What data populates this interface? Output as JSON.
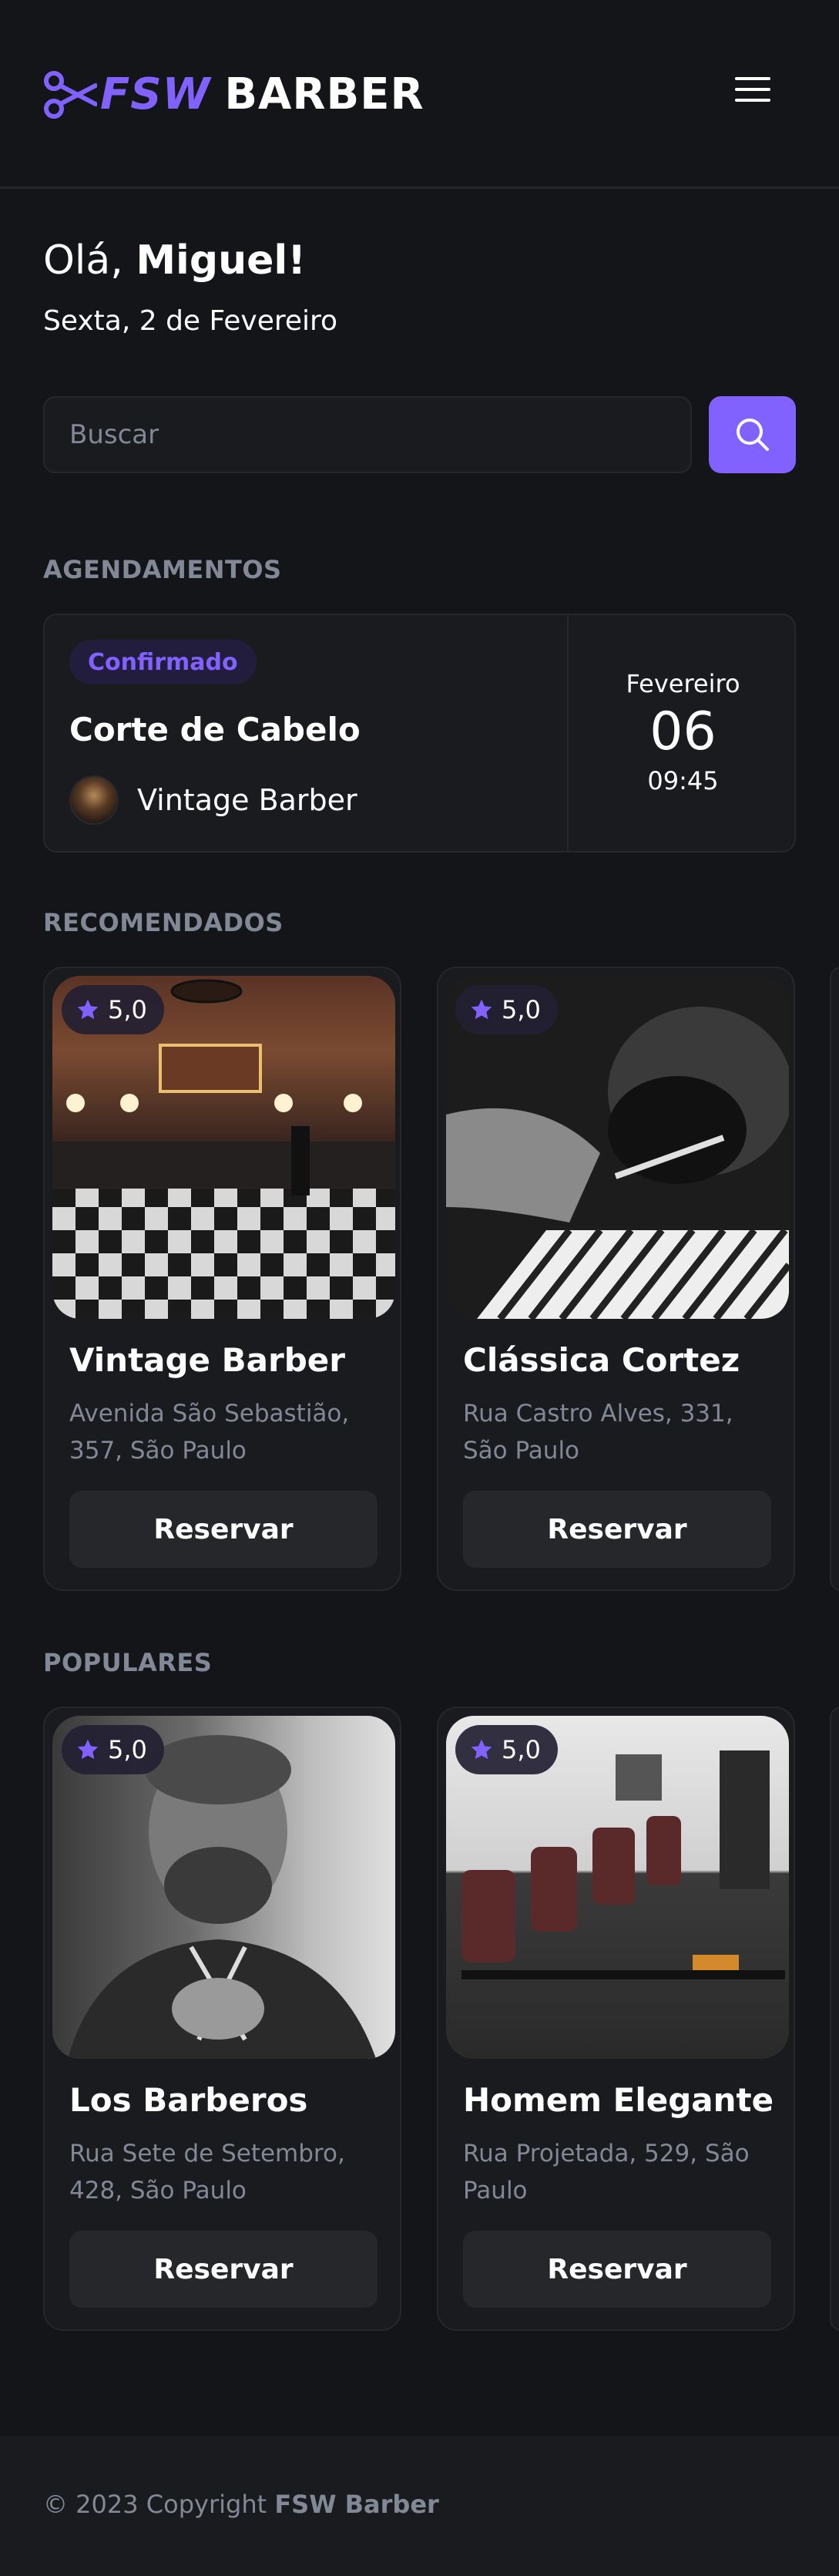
{
  "header": {
    "logo_part1": "FSW",
    "logo_part2": "BARBER",
    "brand_color": "#8162ff",
    "menu_icon": "hamburger-menu-icon"
  },
  "welcome": {
    "greeting_prefix": "Olá, ",
    "user_name": "Miguel!",
    "date": "Sexta, 2 de Fevereiro"
  },
  "search": {
    "placeholder": "Buscar",
    "button_icon": "search-icon"
  },
  "bookings": {
    "section_title": "Agendamentos",
    "items": [
      {
        "status": "Confirmado",
        "service": "Corte de Cabelo",
        "barbershop": "Vintage Barber",
        "month": "Fevereiro",
        "day": "06",
        "time": "09:45"
      }
    ]
  },
  "recommended": {
    "section_title": "Recomendados",
    "items": [
      {
        "rating": "5,0",
        "name": "Vintage Barber",
        "address": "Avenida São Sebastião, 357, São Paulo",
        "button": "Reservar"
      },
      {
        "rating": "5,0",
        "name": "Clássica Cortez",
        "address": "Rua Castro Alves, 331, São Paulo",
        "button": "Reservar"
      }
    ]
  },
  "popular": {
    "section_title": "Populares",
    "items": [
      {
        "rating": "5,0",
        "name": "Los Barberos",
        "address": "Rua Sete de Setembro, 428, São Paulo",
        "button": "Reservar"
      },
      {
        "rating": "5,0",
        "name": "Homem Elegante",
        "address": "Rua Projetada, 529, São Paulo",
        "button": "Reservar"
      }
    ]
  },
  "footer": {
    "copyright_prefix": "© 2023 Copyright ",
    "brand": "FSW Barber"
  }
}
